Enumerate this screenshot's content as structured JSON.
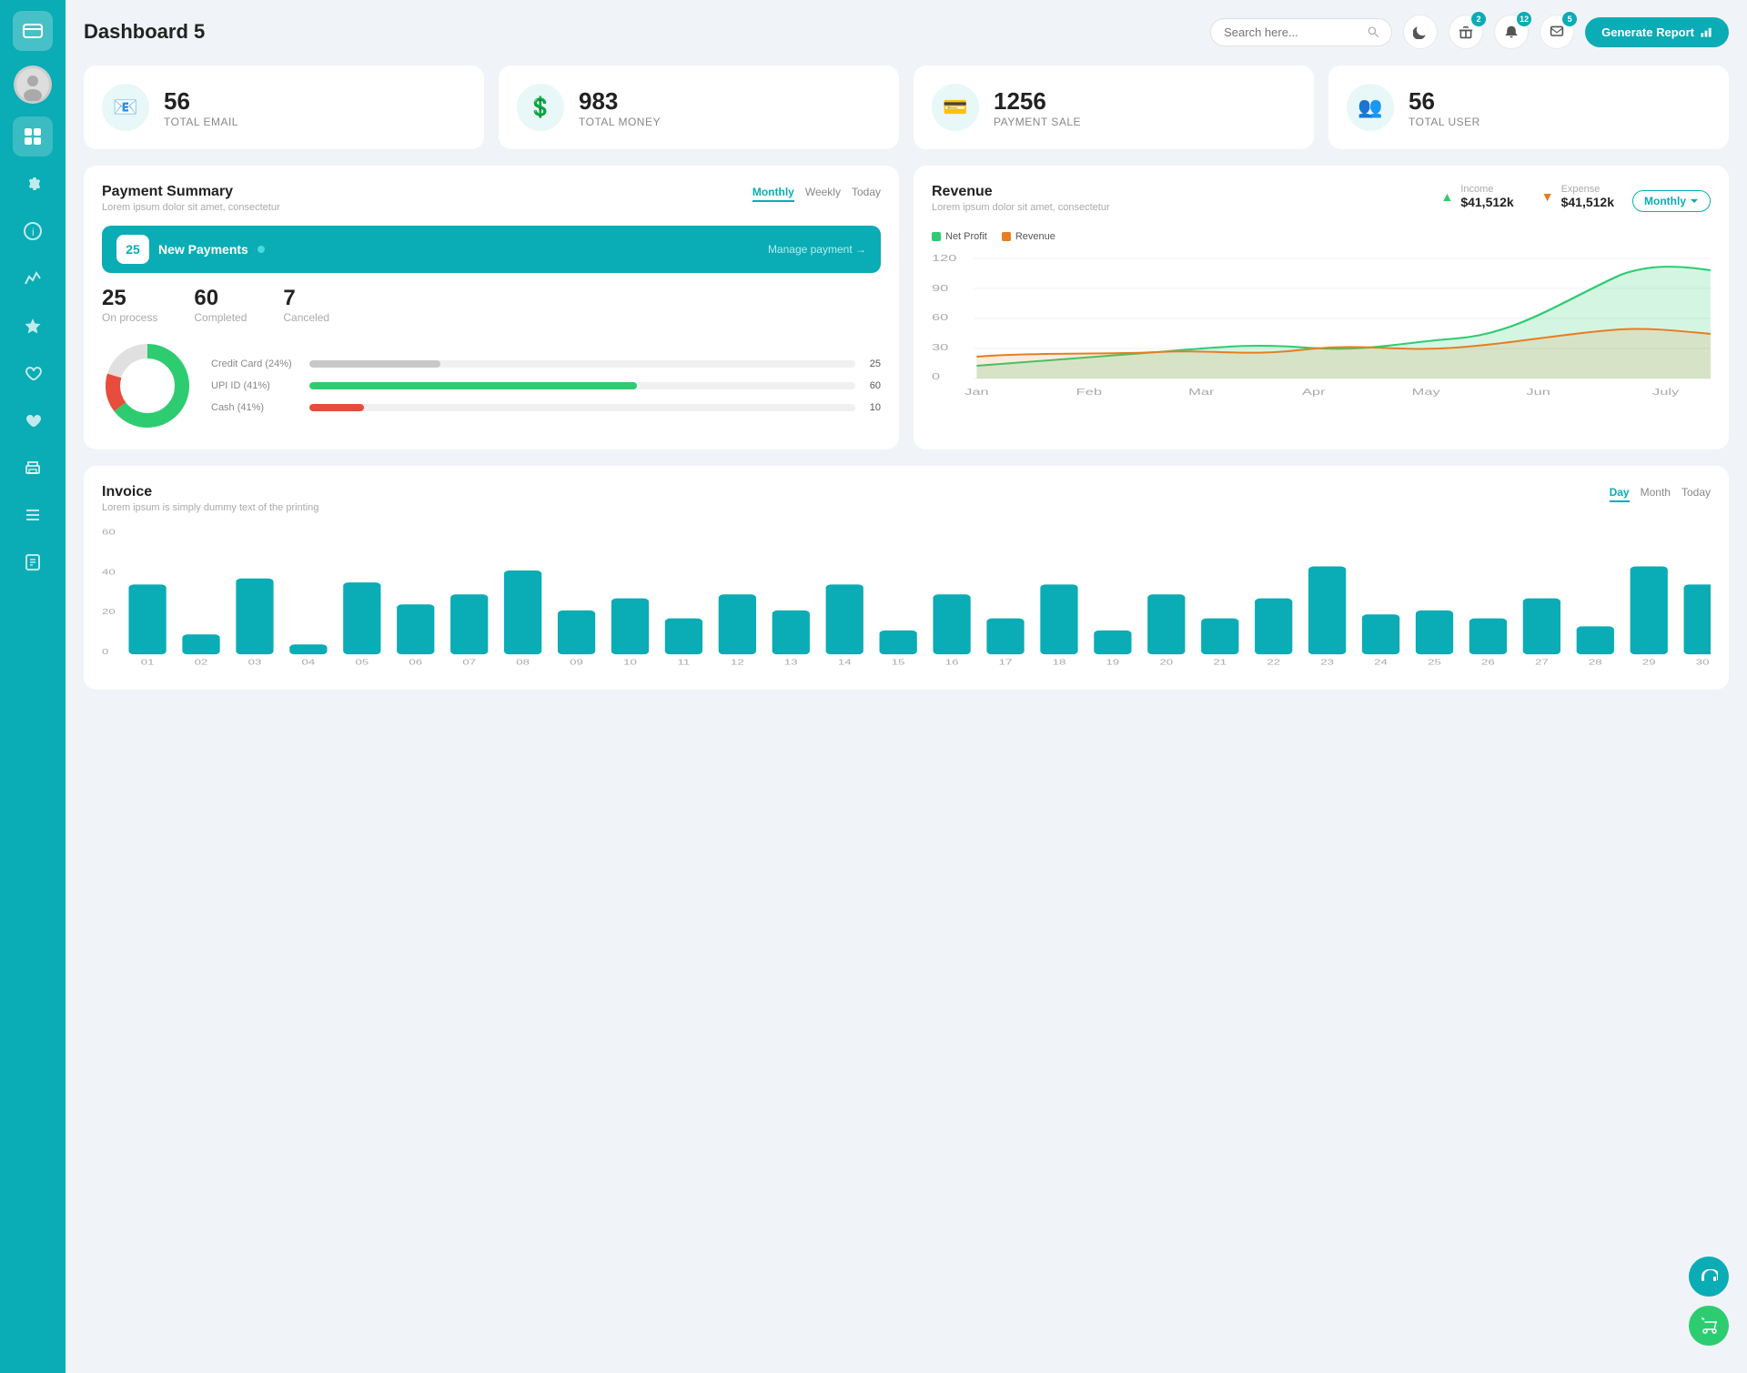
{
  "app": {
    "title": "Dashboard 5",
    "logo": "💳"
  },
  "sidebar": {
    "items": [
      {
        "id": "dashboard",
        "icon": "⊞",
        "active": true
      },
      {
        "id": "settings",
        "icon": "⚙"
      },
      {
        "id": "info",
        "icon": "ℹ"
      },
      {
        "id": "chart",
        "icon": "📊"
      },
      {
        "id": "star",
        "icon": "★"
      },
      {
        "id": "heart-outline",
        "icon": "♡"
      },
      {
        "id": "heart-fill",
        "icon": "♥"
      },
      {
        "id": "print",
        "icon": "🖨"
      },
      {
        "id": "list",
        "icon": "≡"
      },
      {
        "id": "doc",
        "icon": "📋"
      }
    ]
  },
  "header": {
    "search_placeholder": "Search here...",
    "badge_1": "2",
    "badge_2": "12",
    "badge_3": "5",
    "generate_btn": "Generate Report"
  },
  "stats": [
    {
      "id": "total-email",
      "number": "56",
      "label": "TOTAL EMAIL",
      "icon": "📧"
    },
    {
      "id": "total-money",
      "number": "983",
      "label": "TOTAL MONEY",
      "icon": "💲"
    },
    {
      "id": "payment-sale",
      "number": "1256",
      "label": "PAYMENT SALE",
      "icon": "💳"
    },
    {
      "id": "total-user",
      "number": "56",
      "label": "TOTAL USER",
      "icon": "👥"
    }
  ],
  "payment_summary": {
    "title": "Payment Summary",
    "subtitle": "Lorem ipsum dolor sit amet, consectetur",
    "tabs": [
      "Monthly",
      "Weekly",
      "Today"
    ],
    "active_tab": "Monthly",
    "new_payments_count": "25",
    "new_payments_label": "New Payments",
    "manage_link": "Manage payment →",
    "stats": [
      {
        "number": "25",
        "label": "On process"
      },
      {
        "number": "60",
        "label": "Completed"
      },
      {
        "number": "7",
        "label": "Canceled"
      }
    ],
    "donut": {
      "green_pct": 65,
      "red_pct": 15,
      "gray_pct": 20
    },
    "bars": [
      {
        "label": "Credit Card (24%)",
        "pct": 24,
        "color": "#c8c8c8",
        "val": "25"
      },
      {
        "label": "UPI ID (41%)",
        "pct": 60,
        "color": "#2ecc71",
        "val": "60"
      },
      {
        "label": "Cash (41%)",
        "pct": 10,
        "color": "#e74c3c",
        "val": "10"
      }
    ]
  },
  "revenue": {
    "title": "Revenue",
    "subtitle": "Lorem ipsum dolor sit amet, consectetur",
    "tab": "Monthly",
    "legend": [
      {
        "label": "Net Profit",
        "color": "#2ecc71"
      },
      {
        "label": "Revenue",
        "color": "#e67e22"
      }
    ],
    "income": {
      "label": "Income",
      "value": "$41,512k"
    },
    "expense": {
      "label": "Expense",
      "value": "$41,512k"
    },
    "x_labels": [
      "Jan",
      "Feb",
      "Mar",
      "Apr",
      "May",
      "Jun",
      "July"
    ],
    "y_labels": [
      "120",
      "90",
      "60",
      "30",
      "0"
    ]
  },
  "invoice": {
    "title": "Invoice",
    "subtitle": "Lorem ipsum is simply dummy text of the printing",
    "tabs": [
      "Day",
      "Month",
      "Today"
    ],
    "active_tab": "Day",
    "y_labels": [
      "60",
      "40",
      "20",
      "0"
    ],
    "x_labels": [
      "01",
      "02",
      "03",
      "04",
      "05",
      "06",
      "07",
      "08",
      "09",
      "10",
      "11",
      "12",
      "13",
      "14",
      "15",
      "16",
      "17",
      "18",
      "19",
      "20",
      "21",
      "22",
      "23",
      "24",
      "25",
      "26",
      "27",
      "28",
      "29",
      "30"
    ],
    "bars_data": [
      35,
      10,
      38,
      5,
      36,
      25,
      30,
      42,
      22,
      28,
      18,
      30,
      22,
      35,
      12,
      30,
      18,
      35,
      12,
      30,
      18,
      28,
      44,
      20,
      22,
      18,
      28,
      14,
      44,
      35
    ]
  },
  "floating": {
    "support_icon": "💬",
    "cart_icon": "🛒"
  }
}
